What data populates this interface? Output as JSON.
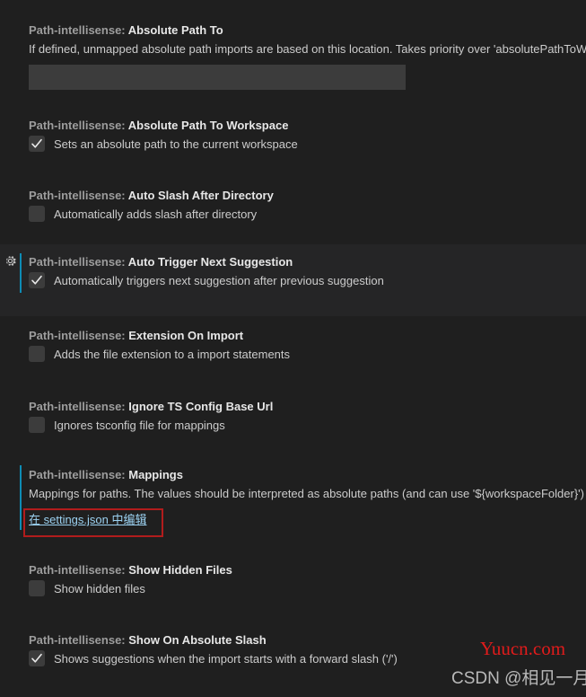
{
  "theme": {
    "background": "#1f1f1f",
    "hover_background": "#252526",
    "accent": "#0e8cb5",
    "control_background": "#3c3c3c",
    "title_category_color": "#9d9d9d",
    "title_name_color": "#e7e7e7",
    "description_color": "#cccccc",
    "link_color": "#9cd2f2",
    "annotation_color": "#b11c1c"
  },
  "settings": [
    {
      "category": "Path-intellisense:",
      "name": "Absolute Path To",
      "description": "If defined, unmapped absolute path imports are based on this location. Takes priority over 'absolutePathToW",
      "control": "text",
      "value": "",
      "placeholder": ""
    },
    {
      "category": "Path-intellisense:",
      "name": "Absolute Path To Workspace",
      "control": "checkbox",
      "checked": true,
      "checkbox_label": "Sets an absolute path to the current workspace"
    },
    {
      "category": "Path-intellisense:",
      "name": "Auto Slash After Directory",
      "control": "checkbox",
      "checked": false,
      "checkbox_label": "Automatically adds slash after directory"
    },
    {
      "category": "Path-intellisense:",
      "name": "Auto Trigger Next Suggestion",
      "control": "checkbox",
      "checked": true,
      "checkbox_label": "Automatically triggers next suggestion after previous suggestion",
      "hovered": true,
      "gear_icon": "gear-icon"
    },
    {
      "category": "Path-intellisense:",
      "name": "Extension On Import",
      "control": "checkbox",
      "checked": false,
      "checkbox_label": "Adds the file extension to a import statements"
    },
    {
      "category": "Path-intellisense:",
      "name": "Ignore TS Config Base Url",
      "control": "checkbox",
      "checked": false,
      "checkbox_label": "Ignores tsconfig file for mappings"
    },
    {
      "category": "Path-intellisense:",
      "name": "Mappings",
      "description": "Mappings for paths. The values should be interpreted as absolute paths (and can use '${workspaceFolder}')",
      "control": "link",
      "link_label": "在 settings.json 中编辑",
      "annotated": true
    },
    {
      "category": "Path-intellisense:",
      "name": "Show Hidden Files",
      "control": "checkbox",
      "checked": false,
      "checkbox_label": "Show hidden files"
    },
    {
      "category": "Path-intellisense:",
      "name": "Show On Absolute Slash",
      "control": "checkbox",
      "checked": true,
      "checkbox_label": "Shows suggestions when the import starts with a forward slash ('/')"
    }
  ],
  "watermarks": {
    "site": "Yuucn.com",
    "author": "CSDN @相见一月"
  }
}
